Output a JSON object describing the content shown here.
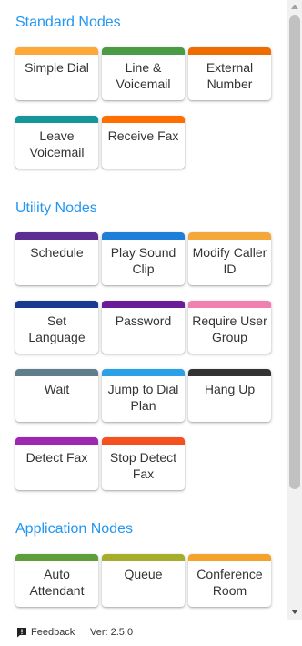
{
  "sections": [
    {
      "title": "Standard Nodes",
      "nodes": [
        {
          "label": "Simple Dial",
          "color": "#ffa83a"
        },
        {
          "label": "Line & Voicemail",
          "color": "#4a9c44"
        },
        {
          "label": "External Number",
          "color": "#ef6c00"
        },
        {
          "label": "Leave Voicemail",
          "color": "#14969a"
        },
        {
          "label": "Receive Fax",
          "color": "#ff6f00"
        }
      ]
    },
    {
      "title": "Utility Nodes",
      "nodes": [
        {
          "label": "Schedule",
          "color": "#5e2d91"
        },
        {
          "label": "Play Sound Clip",
          "color": "#1e7fd8"
        },
        {
          "label": "Modify Caller ID",
          "color": "#f4a83a"
        },
        {
          "label": "Set Language",
          "color": "#1a3a8f"
        },
        {
          "label": "Password",
          "color": "#6a1b9a"
        },
        {
          "label": "Require User Group",
          "color": "#f080b0"
        },
        {
          "label": "Wait",
          "color": "#5f7d8c"
        },
        {
          "label": "Jump to Dial Plan",
          "color": "#2aa0e8"
        },
        {
          "label": "Hang Up",
          "color": "#333333"
        },
        {
          "label": "Detect Fax",
          "color": "#9c27b0"
        },
        {
          "label": "Stop Detect Fax",
          "color": "#f4511e"
        }
      ]
    },
    {
      "title": "Application Nodes",
      "nodes": [
        {
          "label": "Auto Attendant",
          "color": "#5e9e3a"
        },
        {
          "label": "Queue",
          "color": "#a5ad2a"
        },
        {
          "label": "Conference Room",
          "color": "#f4a22a"
        }
      ]
    }
  ],
  "footer": {
    "feedback_label": "Feedback",
    "version_label": "Ver: 2.5.0"
  }
}
